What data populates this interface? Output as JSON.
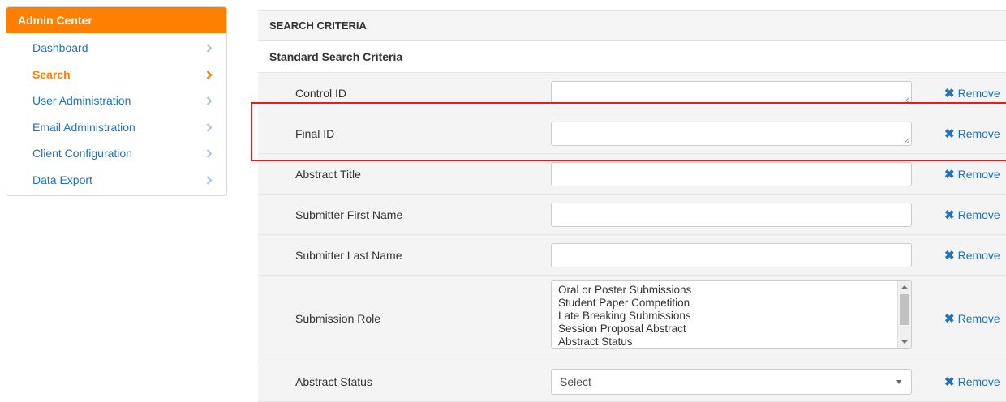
{
  "sidebar": {
    "title": "Admin Center",
    "items": [
      {
        "label": "Dashboard"
      },
      {
        "label": "Search",
        "active": true
      },
      {
        "label": "User Administration"
      },
      {
        "label": "Email Administration"
      },
      {
        "label": "Client Configuration"
      },
      {
        "label": "Data Export"
      }
    ]
  },
  "panel": {
    "header": "SEARCH CRITERIA",
    "section_title": "Standard Search Criteria",
    "remove_label": "Remove",
    "rows": [
      {
        "label": "Control ID",
        "value": ""
      },
      {
        "label": "Final ID",
        "value": ""
      },
      {
        "label": "Abstract Title",
        "value": ""
      },
      {
        "label": "Submitter First Name",
        "value": ""
      },
      {
        "label": "Submitter Last Name",
        "value": ""
      },
      {
        "label": "Submission Role",
        "options": [
          "Oral or Poster Submissions",
          "Student Paper Competition",
          "Late Breaking Submissions",
          "Session Proposal Abstract",
          "Abstract Status"
        ]
      },
      {
        "label": "Abstract Status",
        "selected": "Select"
      }
    ]
  },
  "colors": {
    "accent_orange": "#ff8000",
    "link_blue": "#1f73b7",
    "highlight_red": "#e02020"
  },
  "icons": {
    "sidebar_chevron": "chevron-right-icon",
    "remove": "close-icon",
    "select_caret": "caret-down-icon"
  }
}
